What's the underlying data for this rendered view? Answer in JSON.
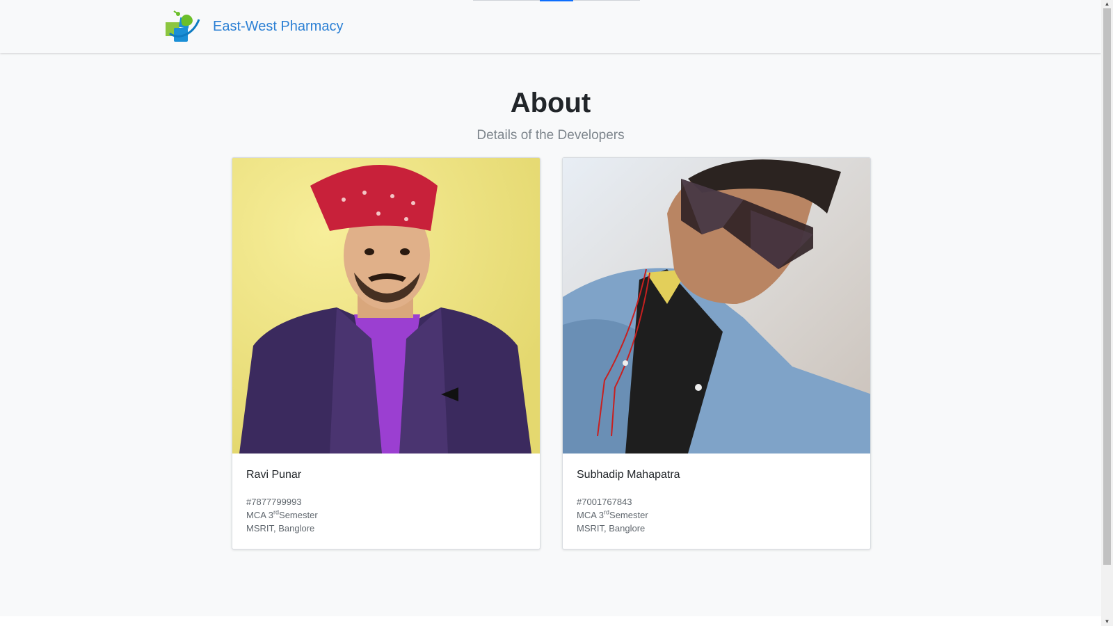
{
  "navbar": {
    "brand_name": "East-West Pharmacy",
    "brand_color": "#2a7fd4"
  },
  "page": {
    "title": "About",
    "subtitle": "Details of the Developers"
  },
  "developers": [
    {
      "name": "Ravi Punar",
      "phone": "#7877799993",
      "course_prefix": "MCA 3",
      "course_sup": "rd",
      "course_suffix": "Semester",
      "college": "MSRIT, Banglore"
    },
    {
      "name": "Subhadip Mahapatra",
      "phone": "#7001767843",
      "course_prefix": "MCA 3",
      "course_sup": "rd",
      "course_suffix": "Semester",
      "college": "MSRIT, Banglore"
    }
  ],
  "icons": {
    "brand_logo": "pharmacy-leaf-cross-logo",
    "scroll_up": "chevron-up-icon",
    "scroll_down": "chevron-down-icon"
  }
}
